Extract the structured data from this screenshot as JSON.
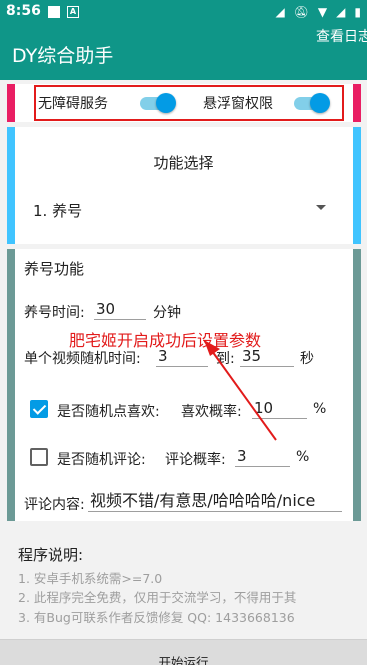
{
  "status_bar": {
    "time": "8:56",
    "badge_letter": "A"
  },
  "app": {
    "title": "DY综合助手",
    "log_button": "查看日志"
  },
  "permissions": {
    "accessibility_label": "无障碍服务",
    "accessibility_on": true,
    "overlay_label": "悬浮窗权限",
    "overlay_on": true
  },
  "function_select": {
    "title": "功能选择",
    "selected": "1. 养号"
  },
  "nurture": {
    "title": "养号功能",
    "time_label": "养号时间:",
    "time_value": "30",
    "time_unit": "分钟",
    "video_time_label": "单个视频随机时间:",
    "video_time_from": "3",
    "video_time_to_label": "到:",
    "video_time_to": "35",
    "video_time_unit": "秒",
    "like_label": "是否随机点喜欢:",
    "like_checked": true,
    "like_rate_label": "喜欢概率:",
    "like_rate_value": "10",
    "like_rate_unit": "%",
    "comment_label": "是否随机评论:",
    "comment_checked": false,
    "comment_rate_label": "评论概率:",
    "comment_rate_value": "3",
    "comment_rate_unit": "%",
    "comment_content_label": "评论内容:",
    "comment_content_value": "视频不错/有意思/哈哈哈哈/nice"
  },
  "annotation": "肥宅姬开启成功后设置参数",
  "description": {
    "title": "程序说明:",
    "lines": [
      "1. 安卓手机系统需>=7.0",
      "2. 此程序完全免费，仅用于交流学习，不得用于其",
      "3. 有Bug可联系作者反馈修复 QQ: 1433668136"
    ]
  },
  "start_button": "开始运行",
  "colors": {
    "primary": "#0f9688",
    "accent": "#039be5",
    "card1_bar": "#e91e63",
    "card2_bar": "#40c4ff",
    "card3_bar": "#6c9a96",
    "annotation": "#e21b1b"
  }
}
